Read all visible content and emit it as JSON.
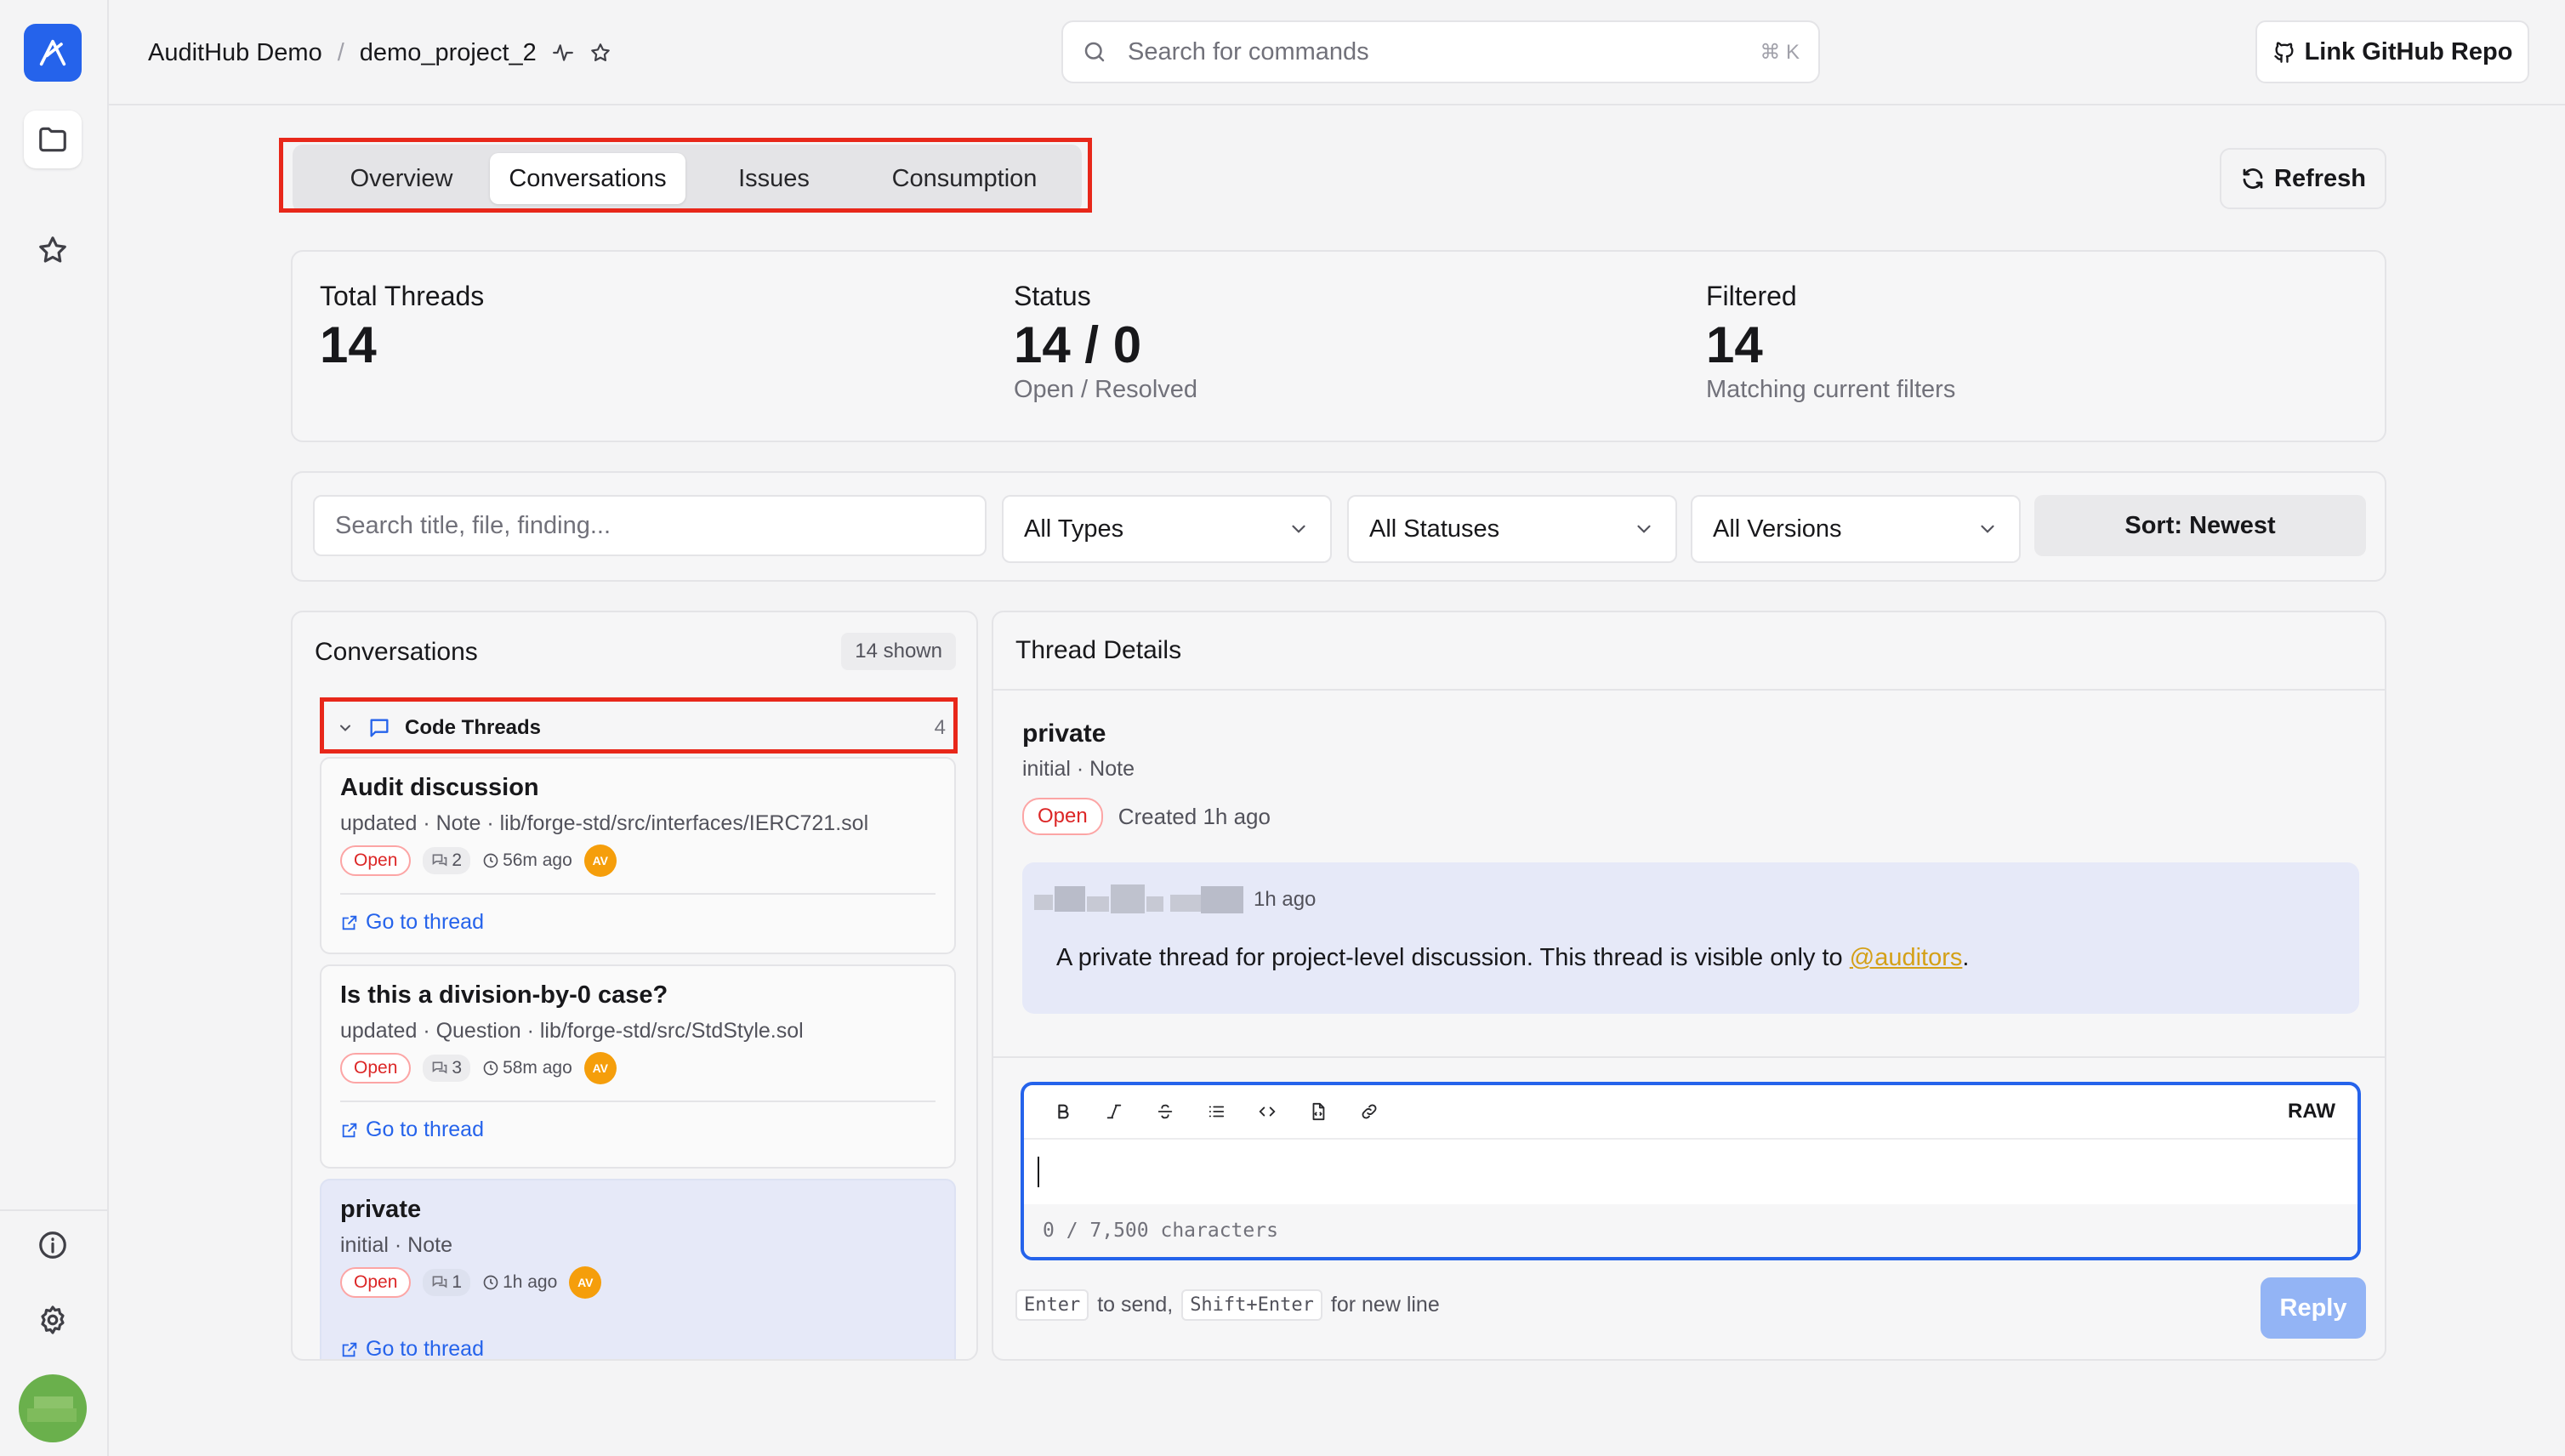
{
  "header": {
    "org": "AuditHub Demo",
    "separator": "/",
    "project": "demo_project_2",
    "search_placeholder": "Search for commands",
    "search_shortcut": "⌘ K",
    "github_button": "Link GitHub Repo"
  },
  "tabs": [
    {
      "label": "Overview",
      "active": false
    },
    {
      "label": "Conversations",
      "active": true
    },
    {
      "label": "Issues",
      "active": false
    },
    {
      "label": "Consumption",
      "active": false
    }
  ],
  "refresh_label": "Refresh",
  "stats": {
    "total": {
      "label": "Total Threads",
      "value": "14"
    },
    "status": {
      "label": "Status",
      "value": "14 / 0",
      "sub": "Open / Resolved"
    },
    "filtered": {
      "label": "Filtered",
      "value": "14",
      "sub": "Matching current filters"
    }
  },
  "filters": {
    "search_placeholder": "Search title, file, finding...",
    "type": "All Types",
    "status": "All Statuses",
    "version": "All Versions",
    "sort": "Sort: Newest"
  },
  "conversations": {
    "title": "Conversations",
    "shown": "14 shown",
    "group": {
      "label": "Code Threads",
      "count": "4"
    },
    "go_label": "Go to thread",
    "items": [
      {
        "title": "Audit discussion",
        "meta": "updated · Note · lib/forge-std/src/interfaces/IERC721.sol",
        "status": "Open",
        "replies": "2",
        "time": "56m ago",
        "avatar": "AV",
        "selected": false
      },
      {
        "title": "Is this a division-by-0 case?",
        "meta": "updated · Question · lib/forge-std/src/StdStyle.sol",
        "status": "Open",
        "replies": "3",
        "time": "58m ago",
        "avatar": "AV",
        "selected": false
      },
      {
        "title": "private",
        "meta": "initial · Note",
        "status": "Open",
        "replies": "1",
        "time": "1h ago",
        "avatar": "AV",
        "selected": true
      }
    ]
  },
  "detail": {
    "header": "Thread Details",
    "title": "private",
    "meta": "initial · Note",
    "status": "Open",
    "created": "Created 1h ago",
    "message": {
      "time": "1h ago",
      "body": "A private thread for project-level discussion. This thread is visible only to ",
      "mention": "@auditors",
      "suffix": "."
    },
    "editor": {
      "raw": "RAW",
      "char_count": "0 / 7,500 characters"
    },
    "hint": {
      "enter": "Enter",
      "to_send": "to send,",
      "shift_enter": "Shift+Enter",
      "new_line": "for new line"
    },
    "reply": "Reply"
  },
  "colors": {
    "accent": "#2563eb",
    "highlight": "#e8271a",
    "open_badge": "#dc2626",
    "avatar": "#f59e0b",
    "mention": "#d4a017"
  }
}
